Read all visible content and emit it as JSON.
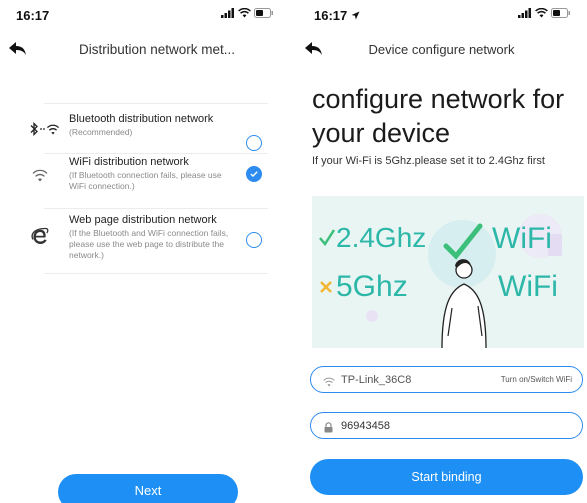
{
  "left_screen": {
    "status_time": "16:17",
    "nav_title": "Distribution network met...",
    "options": [
      {
        "title": "Bluetooth distribution network",
        "subtitle": "(Recommended)",
        "icon": "bluetooth-wifi-icon",
        "selected": false
      },
      {
        "title": "WiFi distribution network",
        "subtitle": "(If Bluetooth connection fails, please use WiFi connection.)",
        "icon": "wifi-icon",
        "selected": true
      },
      {
        "title": "Web page distribution network",
        "subtitle": "(If the Bluetooth and WiFi connection fails, please use the web page to distribute the network.)",
        "icon": "internet-explorer-icon",
        "selected": false
      }
    ],
    "next_label": "Next"
  },
  "right_screen": {
    "status_time": "16:17",
    "nav_title": "Device configure network",
    "heading": "configure network for your device",
    "hint": "If your Wi-Fi is 5Ghz.please set it to 2.4Ghz first",
    "illustration": {
      "good_freq": "2.4Ghz",
      "good_label": "WiFi",
      "bad_freq": "5Ghz",
      "bad_label": "WiFi",
      "check_color": "#3cbf7a",
      "cross_color": "#f2b632",
      "text_color": "#2cb7a8"
    },
    "wifi_field": {
      "ssid": "TP-Link_36C8",
      "switch_label": "Turn on/Switch WiFi"
    },
    "password_field": {
      "value": "96943458"
    },
    "start_label": "Start binding"
  },
  "colors": {
    "accent": "#1e90f5",
    "radio": "#2e8cf0"
  }
}
